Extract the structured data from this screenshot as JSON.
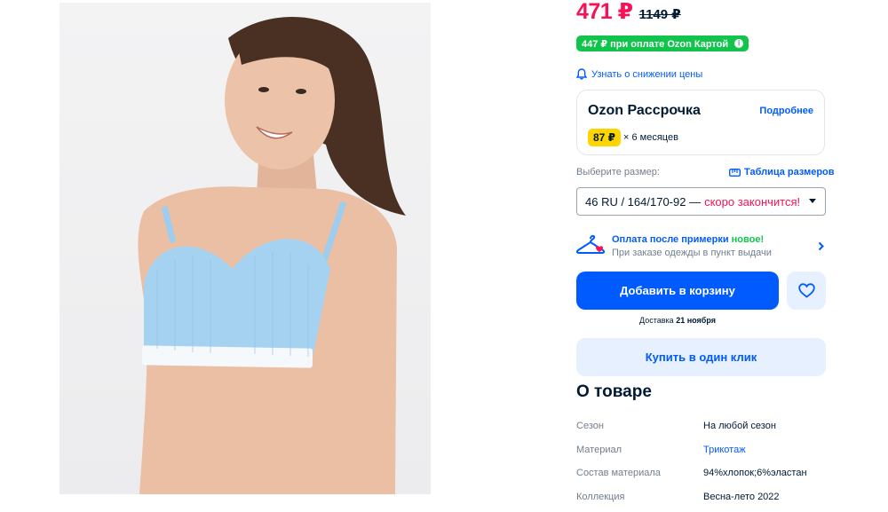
{
  "price": {
    "current": "471 ₽",
    "old": "1149 ₽"
  },
  "card_offer": {
    "text": "447 ₽ при оплате Ozon Картой",
    "icon": "info-icon",
    "color": "#10c44c"
  },
  "notify": {
    "label": "Узнать о снижении цены",
    "icon": "bell-icon"
  },
  "installment": {
    "title": "Ozon Рассрочка",
    "more_label": "Подробнее",
    "amount": "87 ₽",
    "months": "× 6 месяцев"
  },
  "size": {
    "label": "Выберите размер:",
    "table_label": "Таблица размеров",
    "table_icon": "ruler-icon",
    "selected": "46 RU / 164/170-92 —",
    "warning": "скоро закончится!"
  },
  "tryon": {
    "title": "Оплата после примерки",
    "badge": "новое!",
    "subtitle": "При заказе одежды в пункт выдачи",
    "icon": "hanger-icon"
  },
  "actions": {
    "add_to_cart": "Добавить в корзину",
    "buy_one_click": "Купить в один клик",
    "favorite_icon": "heart-icon"
  },
  "delivery": {
    "prefix": "Доставка",
    "date": "21 ноября"
  },
  "about": {
    "title": "О товаре",
    "specs": [
      {
        "key": "Сезон",
        "value": "На любой сезон"
      },
      {
        "key": "Материал",
        "value": "Трикотаж"
      },
      {
        "key": "Состав материала",
        "value": "94%хлопок;6%эластан"
      },
      {
        "key": "Коллекция",
        "value": "Весна-лето 2022"
      }
    ]
  },
  "colors": {
    "accent": "#005bff",
    "price": "#f91155",
    "promo": "#10c44c",
    "installment_chip": "#ffd500"
  }
}
